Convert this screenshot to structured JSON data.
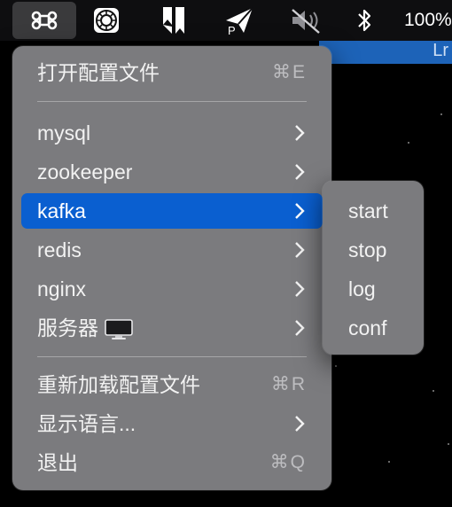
{
  "menubar": {
    "items": [
      {
        "name": "command-icon"
      },
      {
        "name": "dial-icon"
      },
      {
        "name": "bookmark-app-icon"
      },
      {
        "name": "paper-plane-icon"
      },
      {
        "name": "volume-muted-icon"
      },
      {
        "name": "bluetooth-icon"
      }
    ],
    "battery_text": "100%"
  },
  "background_window": {
    "partial_text": "Lr"
  },
  "main_menu": {
    "items": [
      {
        "label": "打开配置文件",
        "shortcut": "⌘E",
        "type": "shortcut"
      },
      {
        "label": "mysql",
        "type": "submenu"
      },
      {
        "label": "zookeeper",
        "type": "submenu"
      },
      {
        "label": "kafka",
        "type": "submenu",
        "selected": true
      },
      {
        "label": "redis",
        "type": "submenu"
      },
      {
        "label": "nginx",
        "type": "submenu"
      },
      {
        "label": "服务器",
        "icon": "monitor-icon",
        "type": "submenu"
      },
      {
        "label": "重新加载配置文件",
        "shortcut": "⌘R",
        "type": "shortcut"
      },
      {
        "label": "显示语言...",
        "type": "submenu"
      },
      {
        "label": "退出",
        "shortcut": "⌘Q",
        "type": "shortcut"
      }
    ]
  },
  "submenu": {
    "parent": "kafka",
    "items": [
      "start",
      "stop",
      "log",
      "conf"
    ]
  },
  "colors": {
    "menu_background": "#7b7b7e",
    "selection": "#0a5fd0",
    "menubar": "#0e0e10",
    "desktop": "#000000"
  }
}
